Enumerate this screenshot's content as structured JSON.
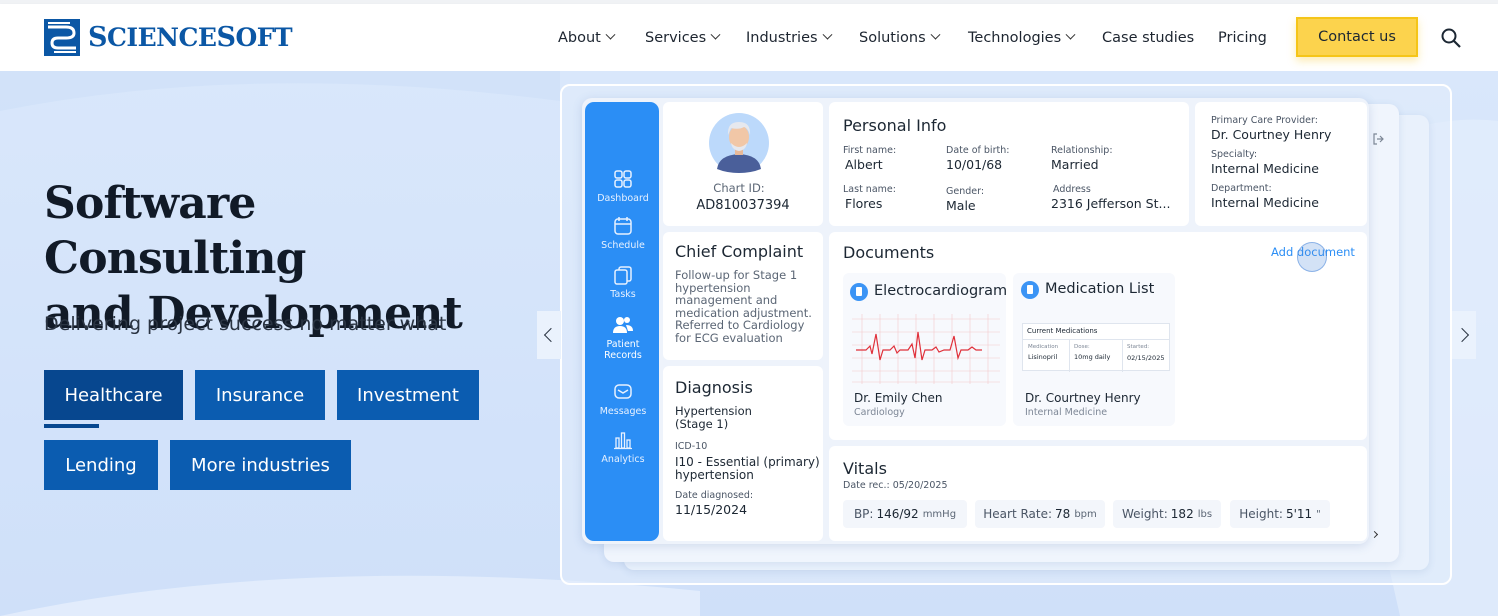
{
  "brand": {
    "logo_icon": "sciencesoft-logo-icon",
    "name_part1": "S",
    "name_part2": "CIENCE",
    "name_part3": "S",
    "name_part4": "OFT"
  },
  "nav": {
    "items": [
      {
        "label": "About",
        "has_dropdown": true
      },
      {
        "label": "Services",
        "has_dropdown": true
      },
      {
        "label": "Industries",
        "has_dropdown": true
      },
      {
        "label": "Solutions",
        "has_dropdown": true
      },
      {
        "label": "Technologies",
        "has_dropdown": true
      },
      {
        "label": "Case studies",
        "has_dropdown": false
      },
      {
        "label": "Pricing",
        "has_dropdown": false
      }
    ],
    "contact_label": "Contact us",
    "search_icon": "search-icon"
  },
  "hero": {
    "title_line1": "Software Consulting",
    "title_line2": "and Development",
    "subtitle": "Delivering project success no matter what",
    "industries": [
      {
        "label": "Healthcare",
        "active": true
      },
      {
        "label": "Insurance"
      },
      {
        "label": "Investment"
      },
      {
        "label": "Lending"
      },
      {
        "label": "More industries"
      }
    ]
  },
  "dashboard": {
    "sidebar": [
      {
        "label": "Dashboard",
        "icon": "grid-icon"
      },
      {
        "label": "Schedule",
        "icon": "calendar-icon"
      },
      {
        "label": "Tasks",
        "icon": "tasks-icon"
      },
      {
        "label": "Patient",
        "label2": "Records",
        "icon": "patients-icon"
      },
      {
        "label": "Messages",
        "icon": "messages-icon"
      },
      {
        "label": "Analytics",
        "icon": "analytics-icon"
      }
    ],
    "patient": {
      "chart_id_label": "Chart ID:",
      "chart_id": "AD810037394"
    },
    "personal_info": {
      "title": "Personal Info",
      "first_name_label": "First name:",
      "first_name": "Albert",
      "dob_label": "Date of birth:",
      "dob": "10/01/68",
      "relationship_label": "Relationship:",
      "relationship": "Married",
      "last_name_label": "Last name:",
      "last_name": "Flores",
      "gender_label": "Gender:",
      "gender": "Male",
      "address_label": "Address",
      "address": "2316 Jefferson St..."
    },
    "provider": {
      "pcp_label": "Primary Care Provider:",
      "pcp": "Dr. Courtney Henry",
      "specialty_label": "Specialty:",
      "specialty": "Internal Medicine",
      "department_label": "Department:",
      "department": "Internal Medicine"
    },
    "chief_complaint": {
      "title": "Chief Complaint",
      "lines": [
        "Follow-up for Stage 1",
        "hypertension",
        "management and",
        "medication adjustment.",
        "Referred to Cardiology",
        "for ECG evaluation"
      ]
    },
    "diagnosis": {
      "title": "Diagnosis",
      "name_line1": "Hypertension",
      "name_line2": "(Stage 1)",
      "icd_label": "ICD-10",
      "icd_line1": "I10 - Essential (primary)",
      "icd_line2": "hypertension",
      "date_label": "Date diagnosed:",
      "date": "11/15/2024"
    },
    "documents": {
      "title": "Documents",
      "add_label": "Add document",
      "items": [
        {
          "title": "Electrocardiogram",
          "doctor": "Dr. Emily Chen",
          "department": "Cardiology"
        },
        {
          "title": "Medication List",
          "doctor": "Dr. Courtney Henry",
          "department": "Internal Medicine",
          "table_title": "Current Medications",
          "col1": "Medication",
          "col2": "Dose:",
          "col3": "Started:",
          "row_med": "Lisinopril",
          "row_dose": "10mg daily",
          "row_started": "02/15/2025"
        }
      ]
    },
    "vitals": {
      "title": "Vitals",
      "date_label": "Date rec.: 05/20/2025",
      "items": [
        {
          "label": "BP:",
          "value": "146/92",
          "unit": "mmHg"
        },
        {
          "label": "Heart Rate:",
          "value": "78",
          "unit": "bpm"
        },
        {
          "label": "Weight:",
          "value": "182",
          "unit": "lbs"
        },
        {
          "label": "Height:",
          "value": "5'11",
          "unit": "\""
        }
      ]
    }
  },
  "colors": {
    "brand_blue": "#0b57a5",
    "accent_yellow": "#fcd34d",
    "sidebar_blue": "#2b8ef5",
    "ecg_red": "#e0303a"
  }
}
